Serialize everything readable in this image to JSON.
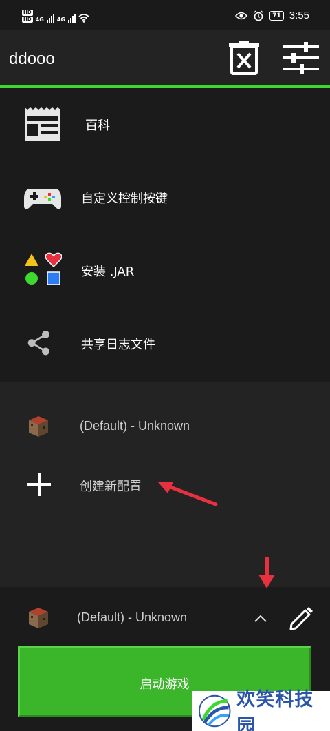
{
  "status_bar": {
    "hd_labels": [
      "HD",
      "HD"
    ],
    "network_1": "4G",
    "network_2": "4G",
    "battery": "71",
    "time": "3:55",
    "icons": [
      "wifi-icon",
      "eye-icon",
      "alarm-icon",
      "battery-icon"
    ]
  },
  "toolbar": {
    "title": "ddooo",
    "icons": [
      "delete-log-icon",
      "settings-sliders-icon"
    ]
  },
  "menu": {
    "items": [
      {
        "label": "百科",
        "icon": "news-icon"
      },
      {
        "label": "自定义控制按键",
        "icon": "gamepad-icon"
      },
      {
        "label": "安装 .JAR",
        "icon": "shapes-icon"
      },
      {
        "label": "共享日志文件",
        "icon": "share-icon"
      }
    ]
  },
  "profiles": {
    "default_profile": "(Default) - Unknown",
    "create_new": "创建新配置",
    "icons": [
      "block-icon",
      "plus-icon"
    ]
  },
  "bottom": {
    "selected_profile": "(Default) - Unknown",
    "launch_label": "启动游戏",
    "icons": [
      "chevron-up-icon",
      "edit-pencil-icon"
    ]
  },
  "watermark": {
    "text": "欢笑科技园"
  },
  "colors": {
    "accent": "#3ed92f",
    "launch_button": "#3bb52a",
    "annotation_arrow": "#e8313f",
    "background": "#1b1b1b"
  }
}
